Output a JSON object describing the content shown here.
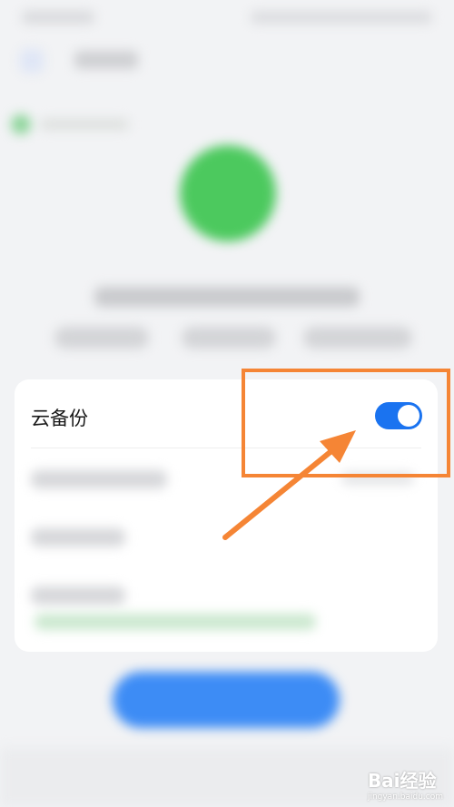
{
  "cloud_backup": {
    "label": "云备份",
    "enabled": true
  },
  "colors": {
    "toggle_on": "#1a73f0",
    "highlight": "#f58535",
    "status_green": "#4cc95e",
    "primary_button": "#3d8cf5"
  },
  "annotation": {
    "shape": "rectangle-with-arrow",
    "target": "cloud-backup-toggle"
  },
  "watermark": {
    "text": "Bai经验",
    "sub": "jingyan.baidu.com"
  }
}
